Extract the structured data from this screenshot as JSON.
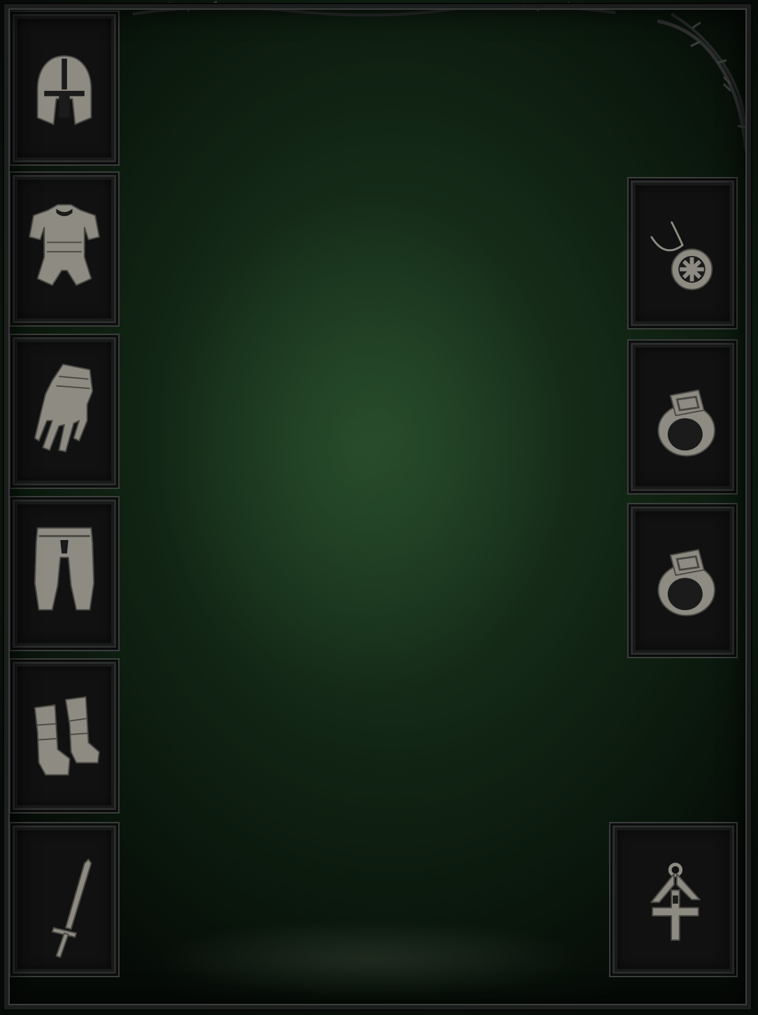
{
  "screen": "equipment-panel",
  "colors": {
    "background": "#1f3b22",
    "slot_fill": "#101110",
    "slot_border": "#3b3e3c",
    "icon": "#8d8b82"
  },
  "left_slots": [
    {
      "slot": "helm",
      "icon": "helmet-icon"
    },
    {
      "slot": "chest",
      "icon": "chest-armor-icon"
    },
    {
      "slot": "gloves",
      "icon": "gauntlet-icon"
    },
    {
      "slot": "pants",
      "icon": "pants-icon"
    },
    {
      "slot": "boots",
      "icon": "boots-icon"
    },
    {
      "slot": "main-hand",
      "icon": "sword-icon"
    }
  ],
  "right_slots": [
    {
      "slot": "amulet",
      "icon": "amulet-icon"
    },
    {
      "slot": "ring-1",
      "icon": "ring-icon"
    },
    {
      "slot": "ring-2",
      "icon": "ring-icon"
    },
    {
      "slot": "off-hand",
      "icon": "totem-icon"
    }
  ]
}
